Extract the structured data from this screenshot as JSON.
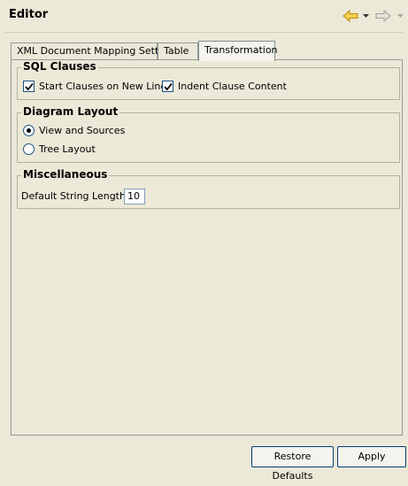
{
  "header": {
    "title": "Editor",
    "back_icon": "arrow-left-icon",
    "forward_icon": "arrow-right-icon",
    "accent_color": "#e7b21b"
  },
  "tabs": [
    {
      "label": "XML Document Mapping Settings",
      "selected": false
    },
    {
      "label": "Table",
      "selected": false
    },
    {
      "label": "Transformation",
      "selected": true
    }
  ],
  "sql_clauses": {
    "title": "SQL Clauses",
    "start_clauses_label": "Start Clauses on New Line",
    "start_clauses_checked": true,
    "indent_clause_label": "Indent Clause Content",
    "indent_clause_checked": true
  },
  "diagram_layout": {
    "title": "Diagram Layout",
    "view_sources_label": "View and Sources",
    "view_sources_selected": true,
    "tree_layout_label": "Tree Layout",
    "tree_layout_selected": false
  },
  "miscellaneous": {
    "title": "Miscellaneous",
    "string_length_label": "Default String Length:",
    "string_length_value": "10"
  },
  "buttons": {
    "restore_defaults": "Restore Defaults",
    "apply": "Apply"
  }
}
